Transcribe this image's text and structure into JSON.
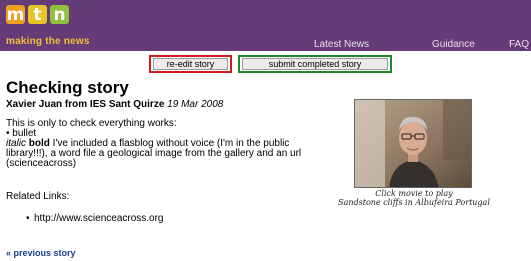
{
  "logo": {
    "letters": [
      "m",
      "t",
      "n"
    ],
    "tagline": "making the news"
  },
  "nav": {
    "latest": "Latest News",
    "guidance": "Guidance",
    "faq": "FAQ"
  },
  "actions": {
    "reedit_label": "re-edit story",
    "submit_label": "submit completed story"
  },
  "story": {
    "title": "Checking story",
    "author": "Xavier Juan from IES Sant Quirze",
    "date": "19 Mar 2008",
    "line1": "This is only to check everything works:",
    "line2": "• bullet",
    "italic_word": "italic",
    "bold_word": "bold",
    "rest_text": " I've included a flasblog without voice (I'm in the public library!!!), a word file a geological image from the gallery and an url (scienceacross)"
  },
  "related": {
    "heading": "Related Links:",
    "links": [
      "http://www.scienceacross.org"
    ]
  },
  "video": {
    "caption_1": "Click movie to play",
    "caption_2": "Sandstone cliffs in Albufeira Portugal"
  },
  "footer": {
    "previous_label": "« previous story"
  },
  "colors": {
    "header_bg": "#663c78",
    "reedit_outline": "#d01c1c",
    "submit_outline": "#1d8a2a",
    "link": "#1c3e8e"
  }
}
